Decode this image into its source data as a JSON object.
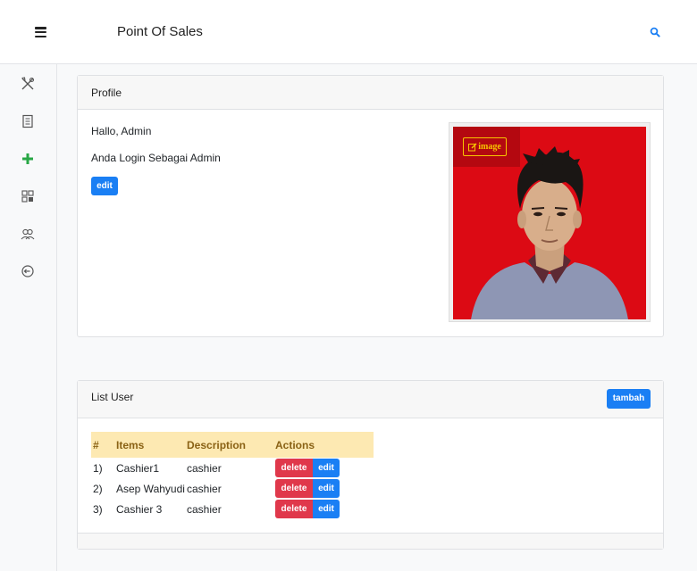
{
  "header": {
    "title": "Point Of Sales"
  },
  "sidebar": {
    "items": [
      {
        "icon": "utensils-icon",
        "label": ""
      },
      {
        "icon": "receipt-icon",
        "label": ""
      },
      {
        "icon": "plus-icon",
        "label": ""
      },
      {
        "icon": "grid-icon",
        "label": ""
      },
      {
        "icon": "users-icon",
        "label": ""
      },
      {
        "icon": "logout-icon",
        "label": ""
      }
    ]
  },
  "profile": {
    "title": "Profile",
    "greeting": "Hallo, Admin",
    "role_text": "Anda Login Sebagai Admin",
    "edit_label": "edit",
    "image_button_label": "image"
  },
  "users": {
    "title": "List User",
    "add_label": "tambah",
    "columns": [
      "#",
      "Items",
      "Description",
      "Actions"
    ],
    "rows": [
      {
        "num": "1)",
        "name": "Cashier1",
        "description": "cashier"
      },
      {
        "num": "2)",
        "name": "Asep Wahyudi",
        "description": "cashier"
      },
      {
        "num": "3)",
        "name": "Cashier 3",
        "description": "cashier"
      }
    ],
    "delete_label": "delete",
    "edit_label": "edit"
  },
  "colors": {
    "primary": "#1a7ff4",
    "danger": "#e0384b",
    "success": "#28a745",
    "warning": "#f7c500",
    "table_header_bg": "#fde9b2",
    "photo_bg": "#dc0a14"
  }
}
